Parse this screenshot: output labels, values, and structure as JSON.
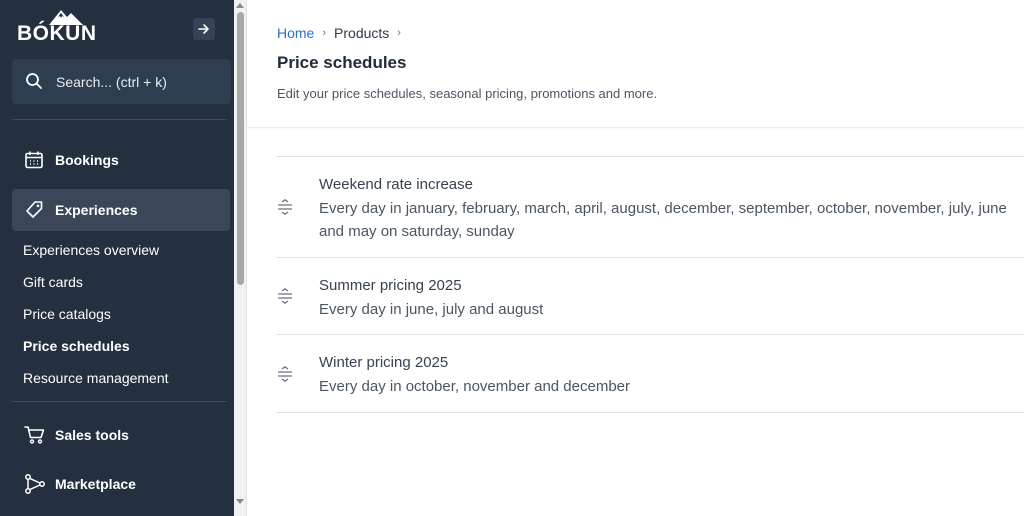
{
  "sidebar": {
    "logo_text": "BÓKUN",
    "search_placeholder": "Search... (ctrl + k)",
    "main_items": [
      {
        "label": "Bookings",
        "icon": "calendar-icon"
      },
      {
        "label": "Experiences",
        "icon": "tag-icon"
      },
      {
        "label": "Sales tools",
        "icon": "cart-icon"
      },
      {
        "label": "Marketplace",
        "icon": "network-icon"
      }
    ],
    "sub_items": [
      {
        "label": "Experiences overview"
      },
      {
        "label": "Gift cards"
      },
      {
        "label": "Price catalogs"
      },
      {
        "label": "Price schedules"
      },
      {
        "label": "Resource management"
      }
    ]
  },
  "breadcrumb": {
    "home": "Home",
    "products": "Products"
  },
  "page": {
    "title": "Price schedules",
    "subtitle": "Edit your price schedules, seasonal pricing, promotions and more."
  },
  "schedules": [
    {
      "name": "Weekend rate increase",
      "description": "Every day in january, february, march, april, august, december, september, october, november, july, june and may on saturday, sunday"
    },
    {
      "name": "Summer pricing 2025",
      "description": "Every day in june, july and august"
    },
    {
      "name": "Winter pricing 2025",
      "description": "Every day in october, november and december"
    }
  ],
  "colors": {
    "sidebar_bg": "#243040",
    "link": "#2a6fc9",
    "active_item": "#3b4758"
  }
}
